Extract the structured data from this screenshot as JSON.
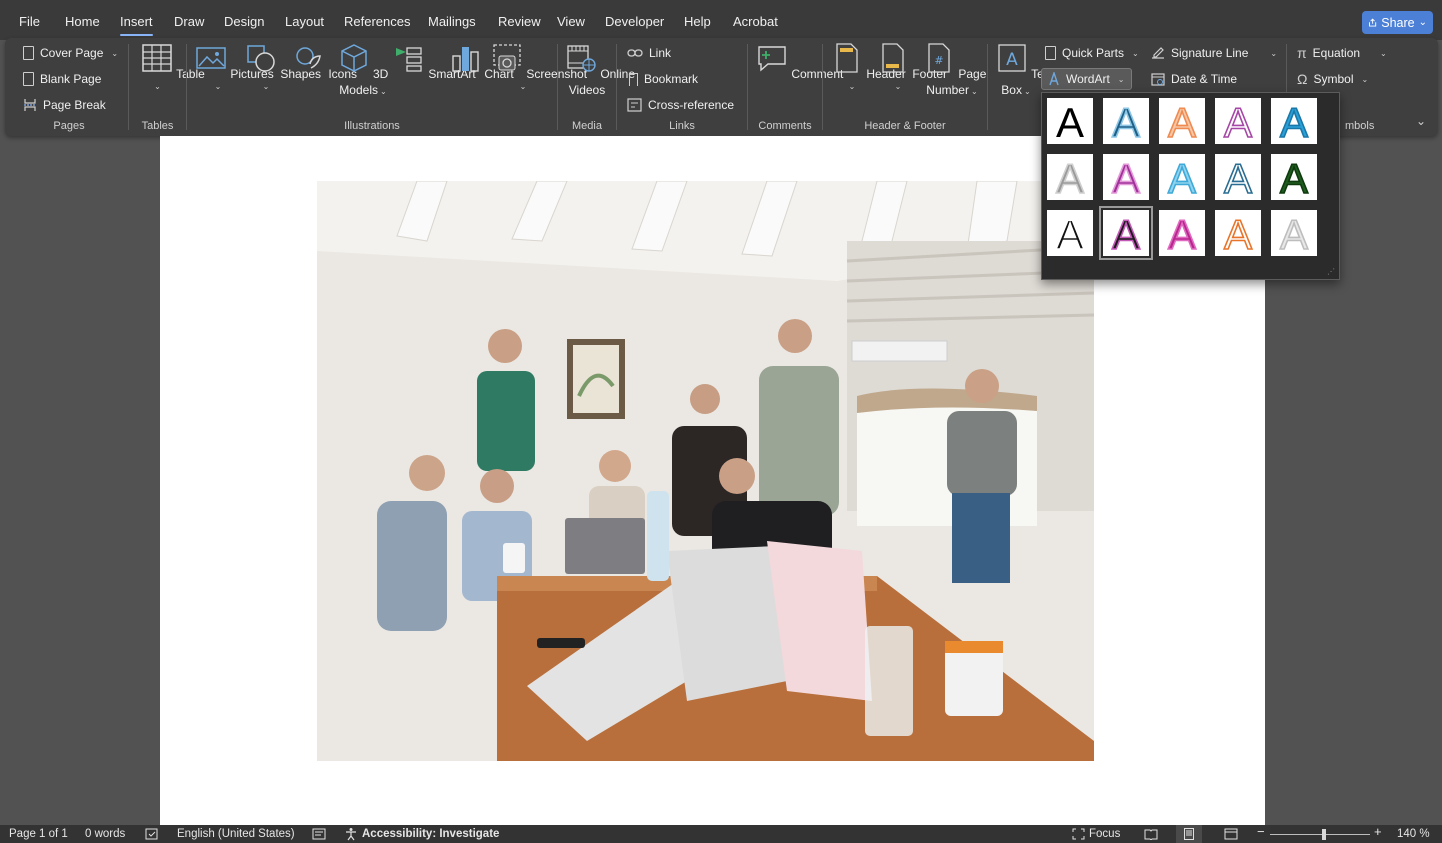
{
  "menu": {
    "tabs": [
      "File",
      "Home",
      "Insert",
      "Draw",
      "Design",
      "Layout",
      "References",
      "Mailings",
      "Review",
      "View",
      "Developer",
      "Help",
      "Acrobat"
    ],
    "active_tab": "Insert",
    "share_label": "Share"
  },
  "ribbon": {
    "pages": {
      "label": "Pages",
      "cover_page": "Cover Page",
      "blank_page": "Blank Page",
      "page_break": "Page Break"
    },
    "tables": {
      "label": "Tables",
      "table": "Table"
    },
    "illustrations": {
      "label": "Illustrations",
      "pictures": "Pictures",
      "shapes": "Shapes",
      "icons": "Icons",
      "models_3d_line1": "3D",
      "models_3d_line2": "Models",
      "smartart": "SmartArt",
      "chart": "Chart",
      "screenshot": "Screenshot"
    },
    "media": {
      "label": "Media",
      "online_videos_line1": "Online",
      "online_videos_line2": "Videos"
    },
    "links": {
      "label": "Links",
      "link": "Link",
      "bookmark": "Bookmark",
      "cross_reference": "Cross-reference"
    },
    "comments": {
      "label": "Comments",
      "comment": "Comment"
    },
    "header_footer": {
      "label": "Header & Footer",
      "header": "Header",
      "footer": "Footer",
      "page_number_line1": "Page",
      "page_number_line2": "Number"
    },
    "text": {
      "text_box_line1": "Text",
      "text_box_line2": "Box",
      "quick_parts": "Quick Parts",
      "wordart": "WordArt",
      "signature_line": "Signature Line",
      "date_time": "Date & Time"
    },
    "symbols": {
      "label_partial": "mbols",
      "equation": "Equation",
      "symbol": "Symbol"
    }
  },
  "wordart_gallery": {
    "glyph": "A",
    "selected_index": 11,
    "styles": [
      {
        "fill": "#000000",
        "stroke": "none"
      },
      {
        "fill": "#1f5f86",
        "stroke": "#8ec6e6"
      },
      {
        "fill": "#f7c7a6",
        "stroke": "#ef8a50"
      },
      {
        "fill": "#ffffff",
        "stroke": "#a646a6"
      },
      {
        "fill": "#2aa0d8",
        "stroke": "#1a78a8"
      },
      {
        "fill": "#9a9a9a",
        "stroke": "#cfcfcf"
      },
      {
        "fill": "#a1309a",
        "stroke": "#e29ad9"
      },
      {
        "fill": "#8fd3ef",
        "stroke": "#3fa9d8"
      },
      {
        "fill": "#ffffff",
        "stroke": "#2a6d92"
      },
      {
        "fill": "#1e5b1e",
        "stroke": "#0e3a0e"
      },
      {
        "fill": "#111111",
        "stroke": "#ffffff"
      },
      {
        "fill": "#1b1b1b",
        "stroke": "#c259b8"
      },
      {
        "fill": "#b7268f",
        "stroke": "#e06ac0"
      },
      {
        "fill": "#ffffff",
        "stroke": "#e8742a"
      },
      {
        "fill": "#e8e8e8",
        "stroke": "#bdbdbd"
      }
    ]
  },
  "status": {
    "page": "Page 1 of 1",
    "words": "0 words",
    "language": "English (United States)",
    "accessibility": "Accessibility: Investigate",
    "focus": "Focus",
    "zoom": "140 %"
  },
  "colors": {
    "accent": "#4c80d6",
    "ribbon_bg": "#3f3f3f",
    "menubar_bg": "#3a3a3a",
    "workspace_bg": "#525252"
  }
}
